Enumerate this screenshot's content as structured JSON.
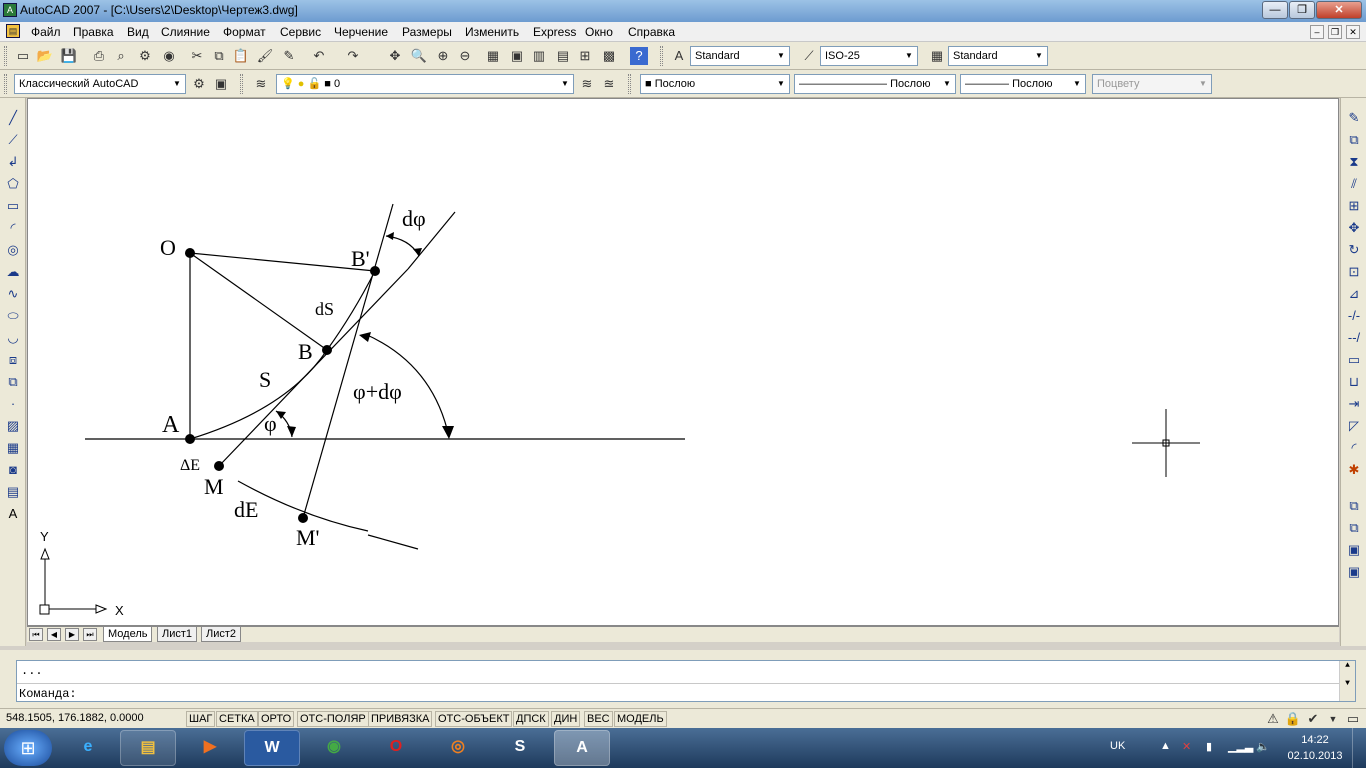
{
  "window": {
    "title": "AutoCAD 2007 - [C:\\Users\\2\\Desktop\\Чертеж3.dwg]",
    "minimize": "—",
    "restore": "❐",
    "close": "✕",
    "doc_min": "–",
    "doc_restore": "❐",
    "doc_close": "✕"
  },
  "menu": [
    "Файл",
    "Правка",
    "Вид",
    "Слияние",
    "Формат",
    "Сервис",
    "Черчение",
    "Размеры",
    "Изменить",
    "Express",
    "Окно",
    "Справка"
  ],
  "toolbar1": {
    "text_style": "Standard",
    "dim_style": "ISO-25",
    "table_style": "Standard"
  },
  "toolbar2": {
    "workspace": "Классический AutoCAD",
    "layer": "0",
    "color": "Послою",
    "linetype": "Послою",
    "lineweight": "Послою",
    "plotstyle": "Поцвету"
  },
  "drawing": {
    "labels": {
      "O": "O",
      "B_prime": "B'",
      "B": "B",
      "A": "A",
      "M": "M",
      "M_prime": "M'",
      "dphi": "dφ",
      "dS": "dS",
      "S": "S",
      "phi": "φ",
      "phi_dphi": "φ+dφ",
      "dE_small": "ΔE",
      "dE": "dE"
    },
    "ucs": {
      "x": "X",
      "y": "Y"
    }
  },
  "tabs": [
    "Модель",
    "Лист1",
    "Лист2"
  ],
  "command": {
    "history": "...",
    "prompt": "Команда:"
  },
  "status": {
    "coords": "548.1505, 176.1882, 0.0000",
    "buttons": [
      "ШАГ",
      "СЕТКА",
      "ОРТО",
      "ОТС-ПОЛЯР",
      "ПРИВЯЗКА",
      "ОТС-ОБЪЕКТ",
      "ДПСК",
      "ДИН",
      "ВЕС",
      "МОДЕЛЬ"
    ]
  },
  "taskbar": {
    "lang": "UK",
    "time": "14:22",
    "date": "02.10.2013",
    "apps": [
      "Internet Explorer",
      "Explorer",
      "Media",
      "Word",
      "Chrome",
      "Opera",
      "Firefox",
      "Skype",
      "AutoCAD"
    ]
  }
}
